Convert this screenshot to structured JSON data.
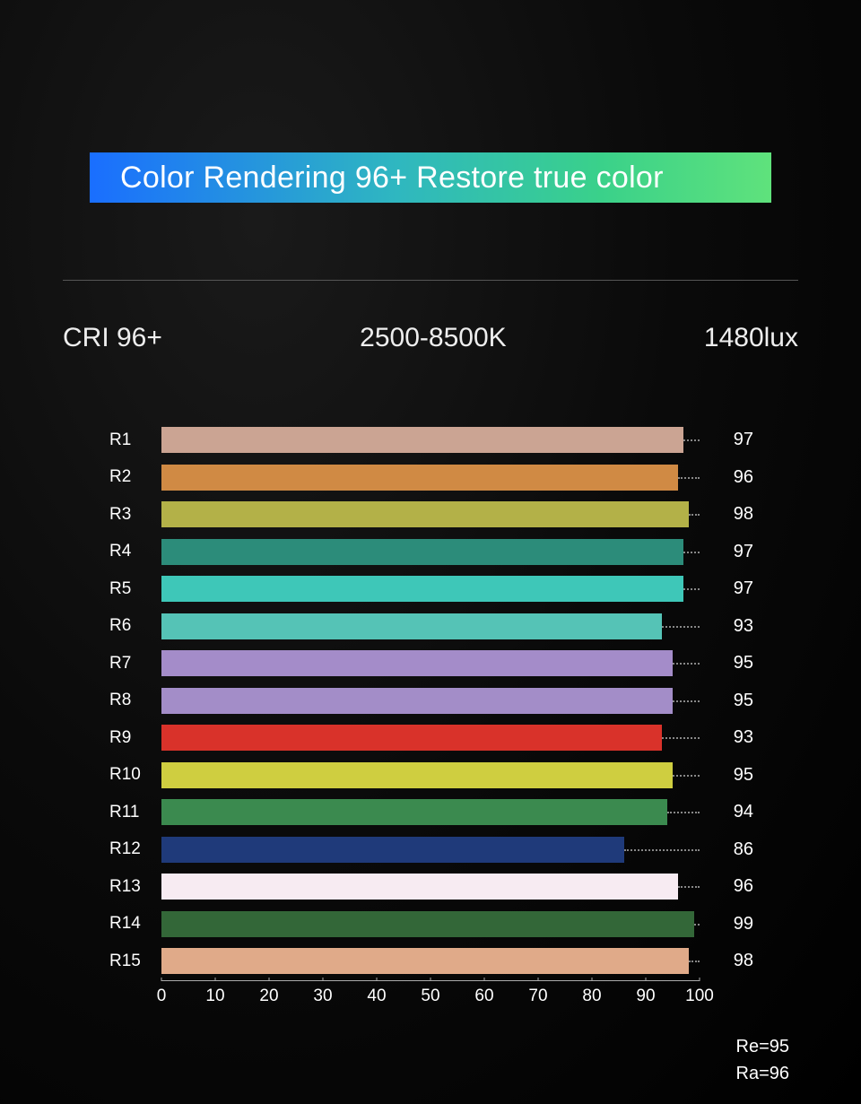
{
  "header": {
    "title": "Color Rendering 96+  Restore true color"
  },
  "specs": {
    "cri": "CRI 96+",
    "cct": "2500-8500K",
    "lux": "1480lux"
  },
  "footer": {
    "re": "Re=95",
    "ra": "Ra=96"
  },
  "chart_data": {
    "type": "bar",
    "title": "Color Rendering 96+  Restore true color",
    "xlabel": "",
    "ylabel": "",
    "xlim": [
      0,
      100
    ],
    "ticks": [
      0,
      10,
      20,
      30,
      40,
      50,
      60,
      70,
      80,
      90,
      100
    ],
    "categories": [
      "R1",
      "R2",
      "R3",
      "R4",
      "R5",
      "R6",
      "R7",
      "R8",
      "R9",
      "R10",
      "R11",
      "R12",
      "R13",
      "R14",
      "R15"
    ],
    "values": [
      97,
      96,
      98,
      97,
      97,
      93,
      95,
      95,
      93,
      95,
      94,
      86,
      96,
      99,
      98
    ],
    "colors": [
      "#cba493",
      "#d08a44",
      "#b3b148",
      "#2c8c7a",
      "#3ec7b8",
      "#55c3b6",
      "#a48cc9",
      "#a38dc8",
      "#d9322a",
      "#cfce40",
      "#3b8a4f",
      "#1f3a7a",
      "#f7ebf2",
      "#336738",
      "#e0aa89"
    ],
    "footer": {
      "re": 95,
      "ra": 96
    }
  }
}
